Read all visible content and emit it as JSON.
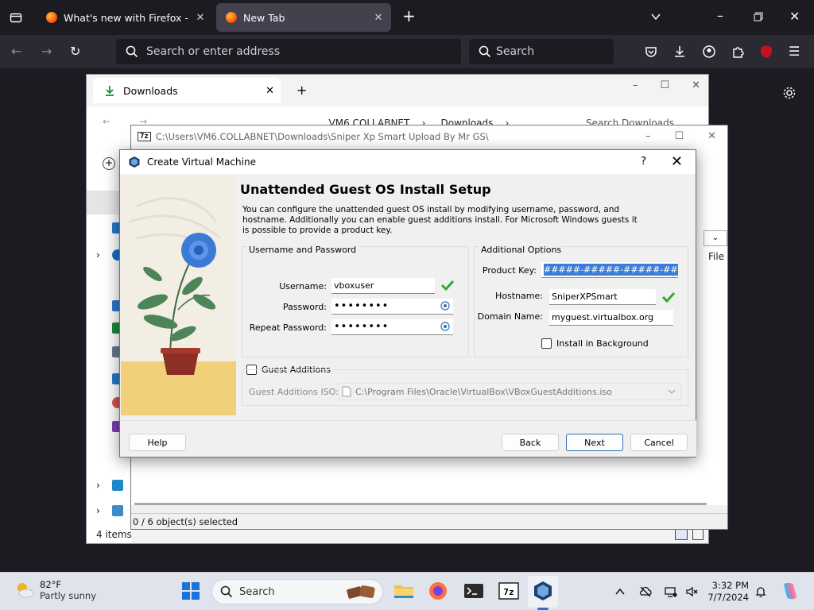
{
  "firefox": {
    "tabs": [
      {
        "title": "What's new with Firefox - More"
      },
      {
        "title": "New Tab"
      }
    ],
    "address_placeholder": "Search or enter address",
    "search_placeholder": "Search"
  },
  "explorer": {
    "tab_title": "Downloads",
    "breadcrumb": [
      "...",
      "VM6.COLLABNET",
      "Downloads"
    ],
    "search_placeholder": "Search Downloads",
    "status": "4 items"
  },
  "sevenzip": {
    "path": "C:\\Users\\VM6.COLLABNET\\Downloads\\Sniper Xp Smart Upload By Mr GS\\",
    "column_file": "File",
    "status": "0 / 6 object(s) selected"
  },
  "dialog": {
    "title": "Create Virtual Machine",
    "help_glyph": "?",
    "heading": "Unattended Guest OS Install Setup",
    "description": "You can configure the unattended guest OS install by modifying username, password, and hostname. Additionally you can enable guest additions install. For Microsoft Windows guests it is possible to provide a product key.",
    "user_group": {
      "title": "Username and Password",
      "username_label": "Username:",
      "username_value": "vboxuser",
      "password_label": "Password:",
      "password_value": "••••••••",
      "repeat_label": "Repeat Password:",
      "repeat_value": "••••••••"
    },
    "options_group": {
      "title": "Additional Options",
      "product_key_label": "Product Key:",
      "product_key_value": "#####-#####-#####-#####-#####",
      "hostname_label": "Hostname:",
      "hostname_value": "SniperXPSmart",
      "domain_label": "Domain Name:",
      "domain_value": "myguest.virtualbox.org",
      "install_bg_label": "Install in Background"
    },
    "guest_additions": {
      "label": "Guest Additions",
      "iso_label": "Guest Additions ISO:",
      "iso_value": "C:\\Program Files\\Oracle\\VirtualBox\\VBoxGuestAdditions.iso"
    },
    "buttons": {
      "help": "Help",
      "back": "Back",
      "next": "Next",
      "cancel": "Cancel"
    }
  },
  "taskbar": {
    "temperature": "82°F",
    "weather": "Partly sunny",
    "search_placeholder": "Search",
    "time": "3:32 PM",
    "date": "7/7/2024"
  },
  "colors": {
    "firefox_bg": "#1c1b22",
    "firefox_toolbar": "#2b2a33",
    "selection_blue": "#3b7dd8",
    "check_green": "#35a82e",
    "dialog_bg": "#f0f0f0"
  }
}
